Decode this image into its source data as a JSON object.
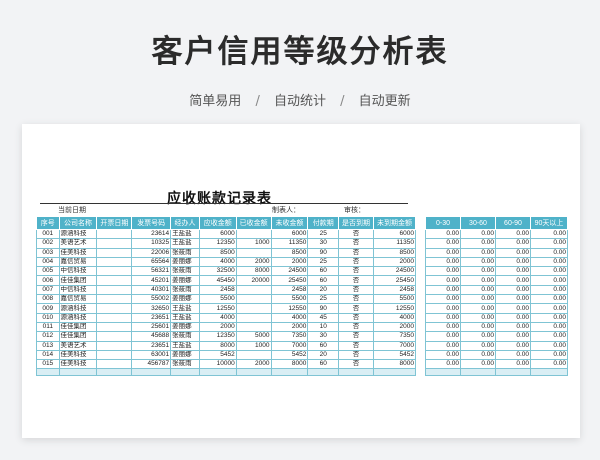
{
  "title": "客户信用等级分析表",
  "subtitle": {
    "items": [
      "简单易用",
      "自动统计",
      "自动更新"
    ],
    "separator": "/"
  },
  "sheet": {
    "heading": "应收账款记录表",
    "meta": {
      "date_label": "当前日期",
      "maker_label": "制表人：",
      "reviewer_label": "审核："
    },
    "headers": [
      "序号",
      "公司名称",
      "开票日期",
      "发票号码",
      "经办人",
      "应收金额",
      "已收金额",
      "未收金额",
      "付款期",
      "是否到期",
      "未到期金额"
    ],
    "rows": [
      [
        "001",
        "源涵科技",
        "",
        "23614",
        "王盐盐",
        "6000",
        "",
        "6000",
        "25",
        "否",
        "6000"
      ],
      [
        "002",
        "美语艺术",
        "",
        "10325",
        "王盐盐",
        "12350",
        "1000",
        "11350",
        "30",
        "否",
        "11350"
      ],
      [
        "003",
        "佳美科技",
        "",
        "22006",
        "张筱雨",
        "8500",
        "",
        "8500",
        "90",
        "否",
        "8500"
      ],
      [
        "004",
        "嘉信贸易",
        "",
        "65564",
        "姜丽娜",
        "4000",
        "2000",
        "2000",
        "25",
        "否",
        "2000"
      ],
      [
        "005",
        "中信科技",
        "",
        "56321",
        "张筱雨",
        "32500",
        "8000",
        "24500",
        "60",
        "否",
        "24500"
      ],
      [
        "006",
        "佳佳集团",
        "",
        "45201",
        "姜丽娜",
        "45450",
        "20000",
        "25450",
        "60",
        "否",
        "25450"
      ],
      [
        "007",
        "中信科技",
        "",
        "40301",
        "张筱雨",
        "2458",
        "",
        "2458",
        "20",
        "否",
        "2458"
      ],
      [
        "008",
        "嘉信贸易",
        "",
        "55002",
        "姜丽娜",
        "5500",
        "",
        "5500",
        "25",
        "否",
        "5500"
      ],
      [
        "009",
        "源涵科技",
        "",
        "32650",
        "王盐盐",
        "12550",
        "",
        "12550",
        "90",
        "否",
        "12550"
      ],
      [
        "010",
        "源涵科技",
        "",
        "23651",
        "王盐盐",
        "4000",
        "",
        "4000",
        "45",
        "否",
        "4000"
      ],
      [
        "011",
        "佳佳集团",
        "",
        "25601",
        "姜丽娜",
        "2000",
        "",
        "2000",
        "10",
        "否",
        "2000"
      ],
      [
        "012",
        "佳佳集团",
        "",
        "45688",
        "张筱雨",
        "12350",
        "5000",
        "7350",
        "30",
        "否",
        "7350"
      ],
      [
        "013",
        "美语艺术",
        "",
        "23651",
        "王盐盐",
        "8000",
        "1000",
        "7000",
        "60",
        "否",
        "7000"
      ],
      [
        "014",
        "佳美科技",
        "",
        "63001",
        "姜丽娜",
        "5452",
        "",
        "5452",
        "20",
        "否",
        "5452"
      ],
      [
        "015",
        "佳美科技",
        "",
        "456787",
        "张筱雨",
        "10000",
        "2000",
        "8000",
        "60",
        "否",
        "8000"
      ]
    ],
    "aging_headers": [
      "0-30",
      "30-60",
      "60-90",
      "90天以上"
    ],
    "aging_rows": [
      [
        "0.00",
        "0.00",
        "0.00",
        "0.00"
      ],
      [
        "0.00",
        "0.00",
        "0.00",
        "0.00"
      ],
      [
        "0.00",
        "0.00",
        "0.00",
        "0.00"
      ],
      [
        "0.00",
        "0.00",
        "0.00",
        "0.00"
      ],
      [
        "0.00",
        "0.00",
        "0.00",
        "0.00"
      ],
      [
        "0.00",
        "0.00",
        "0.00",
        "0.00"
      ],
      [
        "0.00",
        "0.00",
        "0.00",
        "0.00"
      ],
      [
        "0.00",
        "0.00",
        "0.00",
        "0.00"
      ],
      [
        "0.00",
        "0.00",
        "0.00",
        "0.00"
      ],
      [
        "0.00",
        "0.00",
        "0.00",
        "0.00"
      ],
      [
        "0.00",
        "0.00",
        "0.00",
        "0.00"
      ],
      [
        "0.00",
        "0.00",
        "0.00",
        "0.00"
      ],
      [
        "0.00",
        "0.00",
        "0.00",
        "0.00"
      ],
      [
        "0.00",
        "0.00",
        "0.00",
        "0.00"
      ],
      [
        "0.00",
        "0.00",
        "0.00",
        "0.00"
      ]
    ],
    "colors": {
      "header_bg": "#4fb2c9",
      "grid_border": "#7fc4d4",
      "tail_row": "#d9eef4"
    }
  }
}
